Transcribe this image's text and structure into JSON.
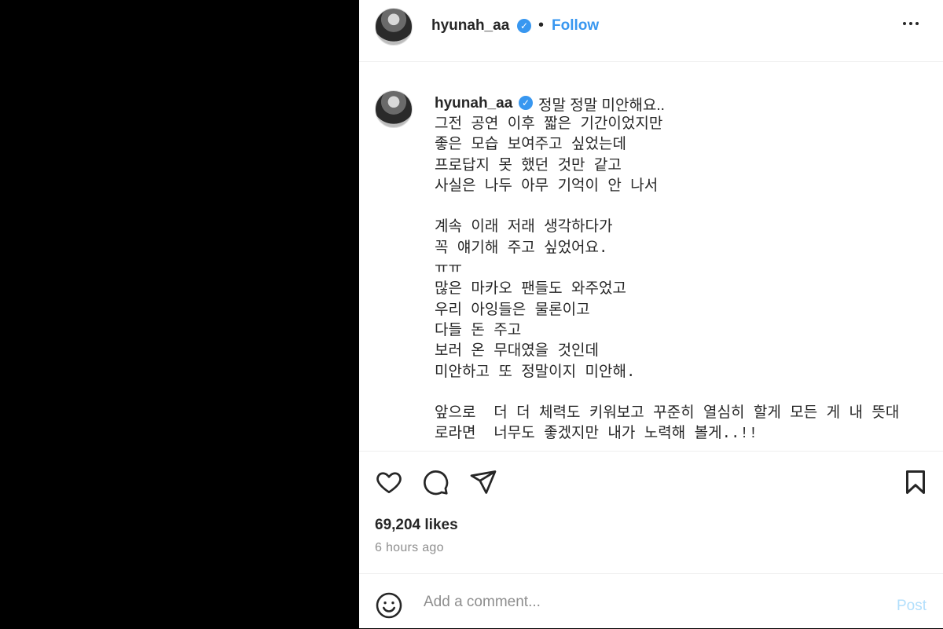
{
  "post": {
    "username": "hyunah_aa",
    "verified_mark": "✓",
    "separator": "•",
    "follow_label": "Follow",
    "more_label": "•••",
    "caption_first_line": "정말 정말 미안해요..",
    "caption_rest": "그전 공연 이후 짧은 기간이었지만\n좋은 모습 보여주고 싶었는데\n프로답지 못 했던 것만 같고\n사실은 나두 아무 기억이 안 나서\n\n계속 이래 저래 생각하다가\n꼭 얘기해 주고 싶었어요.\nㅠㅠ\n많은 마카오 팬들도 와주었고\n우리 아잉들은 물론이고\n다들 돈 주고\n보러 온 무대였을 것인데\n미안하고 또 정말이지 미안해.\n\n앞으로  더 더 체력도 키워보고 꾸준히 열심히 할게 모든 게 내 뜻대\n로라면  너무도 좋겠지만 내가 노력해 볼게..!!",
    "likes": "69,204 likes",
    "time": "6 hours ago",
    "comment_placeholder": "Add a comment...",
    "post_label": "Post"
  },
  "icons": {
    "like": "heart-icon",
    "comment": "comment-bubble-icon",
    "share": "paper-plane-icon",
    "save": "bookmark-icon",
    "emoji": "smiley-icon",
    "more": "more-options-icon"
  },
  "colors": {
    "accent": "#3897f0",
    "post_disabled": "#b2dffc",
    "muted": "#8e8e8e",
    "text": "#262626",
    "left_background": "#000000"
  }
}
